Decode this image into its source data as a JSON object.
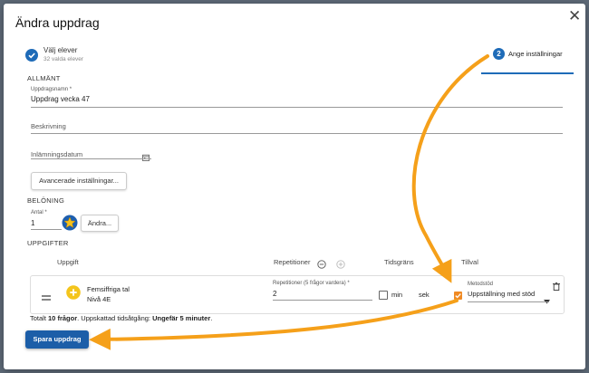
{
  "dialog": {
    "title": "Ändra uppdrag"
  },
  "stepper": {
    "step1": {
      "title": "Välj elever",
      "subtitle": "32 valda elever"
    },
    "step2": {
      "number": "2",
      "label": "Ange inställningar"
    }
  },
  "general": {
    "heading": "ALLMÄNT",
    "name_label": "Uppdragsnamn *",
    "name_value": "Uppdrag vecka 47",
    "description_placeholder": "Beskrivning",
    "due_date_placeholder": "Inlämningsdatum",
    "advanced_button": "Avancerade inställningar..."
  },
  "reward": {
    "heading": "BELÖNING",
    "amount_label": "Antal *",
    "amount_value": "1",
    "change_button": "Ändra..."
  },
  "tasks": {
    "heading": "UPPGIFTER",
    "columns": {
      "task": "Uppgift",
      "repetitions": "Repetitioner",
      "time_limit": "Tidsgräns",
      "extras": "Tillval"
    },
    "items": [
      {
        "title": "Femsiffriga tal",
        "level": "Nivå 4E",
        "repetitions_label": "Repetitioner (5 frågor vardera) *",
        "repetitions_value": "2",
        "min_label": "min",
        "sek_label": "sek",
        "method_label": "Metodstöd",
        "method_value": "Uppställning med stöd",
        "method_checked": true
      }
    ],
    "summary_prefix": "Totalt ",
    "summary_count": "10 frågor",
    "summary_middle": ". Uppskattad tidsåtgång: ",
    "summary_time": "Ungefär 5 minuter",
    "summary_suffix": "."
  },
  "actions": {
    "save": "Spara uppdrag"
  },
  "colors": {
    "primary": "#1c5ea8",
    "annotation": "#f5a01a",
    "plus_icon": "#f4c51c"
  }
}
